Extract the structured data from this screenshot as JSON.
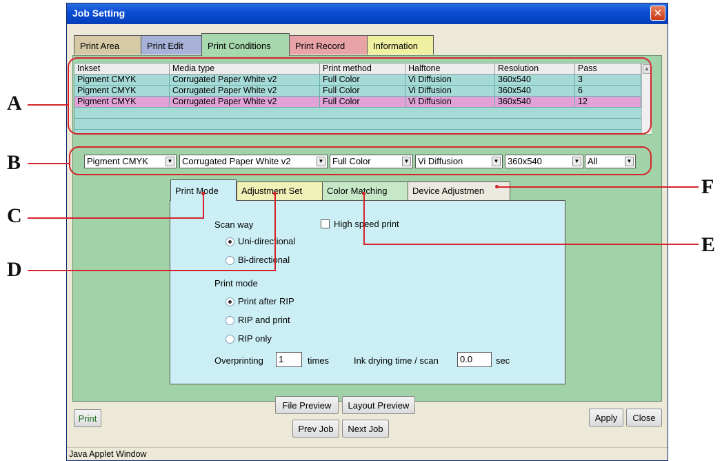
{
  "window": {
    "title": "Job Setting"
  },
  "tabs": [
    "Print Area",
    "Print Edit",
    "Print Conditions",
    "Print Record",
    "Information"
  ],
  "table": {
    "headers": [
      "Inkset",
      "Media type",
      "Print method",
      "Halftone",
      "Resolution",
      "Pass"
    ],
    "rows": [
      [
        "Pigment CMYK",
        "Corrugated Paper White v2",
        "Full Color",
        "Vi Diffusion",
        "360x540",
        "3"
      ],
      [
        "Pigment CMYK",
        "Corrugated Paper White v2",
        "Full Color",
        "Vi Diffusion",
        "360x540",
        "6"
      ],
      [
        "Pigment CMYK",
        "Corrugated Paper White v2",
        "Full Color",
        "Vi Diffusion",
        "360x540",
        "12"
      ]
    ]
  },
  "filters": [
    "Pigment CMYK",
    "Corrugated Paper White v2",
    "Full Color",
    "Vi Diffusion",
    "360x540",
    "All"
  ],
  "subtabs": [
    "Print Mode",
    "Adjustment Set",
    "Color Matching",
    "Device Adjustmen"
  ],
  "print_mode": {
    "scan_way_label": "Scan way",
    "uni_directional": "Uni-directional",
    "bi_directional": "Bi-directional",
    "high_speed_print": "High speed print",
    "print_mode_label": "Print mode",
    "print_after_rip": "Print after RIP",
    "rip_and_print": "RIP and print",
    "rip_only": "RIP only",
    "overprinting_label": "Overprinting",
    "overprinting_value": "1",
    "times_label": "times",
    "ink_drying_label": "Ink drying time / scan",
    "ink_drying_value": "0.0",
    "sec_label": "sec"
  },
  "buttons": {
    "print": "Print",
    "file_preview": "File Preview",
    "layout_preview": "Layout Preview",
    "prev_job": "Prev Job",
    "next_job": "Next Job",
    "apply": "Apply",
    "close": "Close"
  },
  "status_bar": "Java Applet Window",
  "callouts": [
    "A",
    "B",
    "C",
    "D",
    "E",
    "F"
  ],
  "colors": {
    "callout_line": "#d4232a",
    "selected_row": "#e3a2d7",
    "table_row": "#a6dad6",
    "panel_green": "#a2d2a7"
  }
}
